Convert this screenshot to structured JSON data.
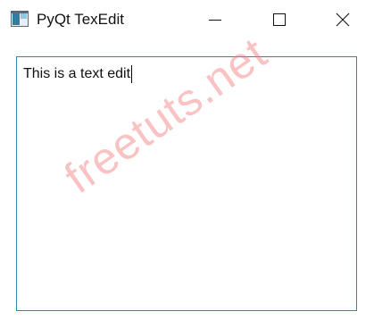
{
  "window": {
    "title": "PyQt TexEdit",
    "app_icon": "pyqt-window-icon",
    "controls": {
      "minimize_icon": "minimize-icon",
      "maximize_icon": "maximize-icon",
      "close_icon": "close-icon"
    }
  },
  "editor": {
    "text": "This is a text edit",
    "border_color": "#2a8ab0"
  },
  "watermark": {
    "text": "freetuts.net",
    "color": "#f47878"
  }
}
